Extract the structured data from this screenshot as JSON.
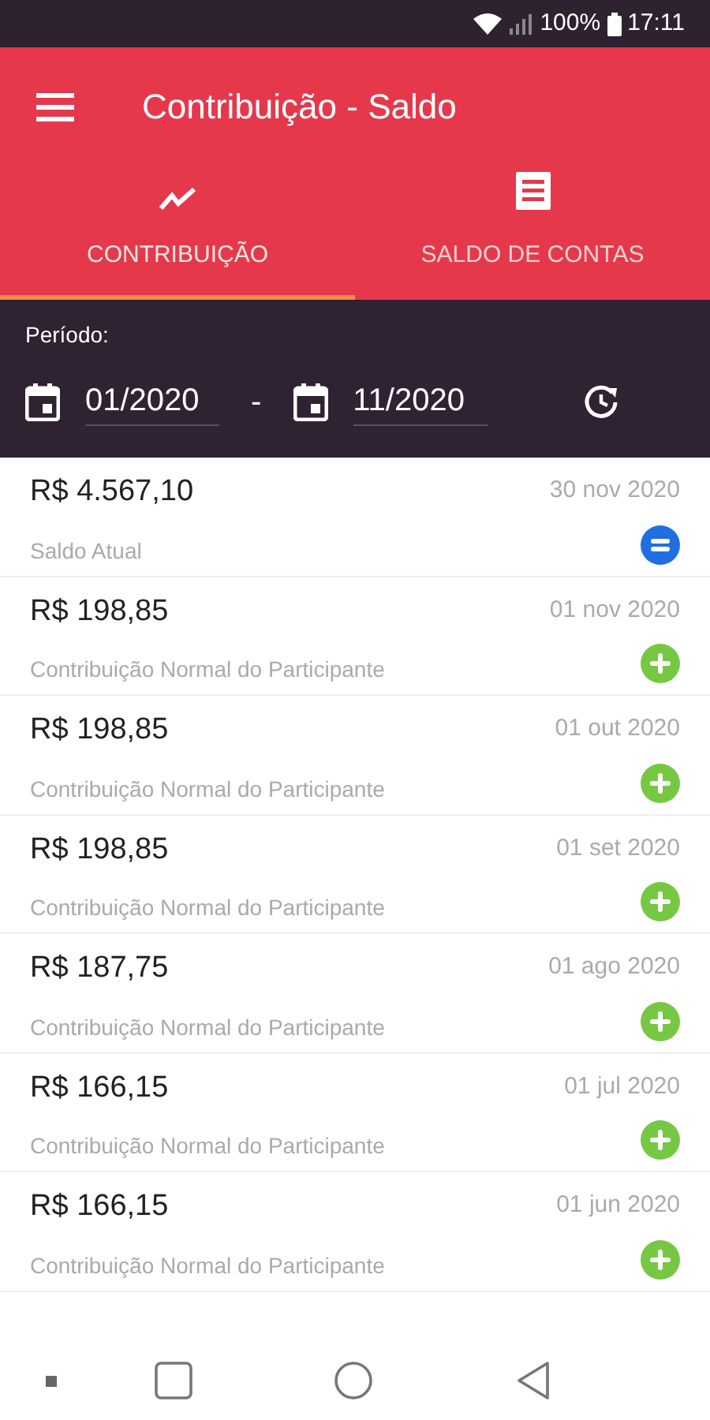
{
  "status_bar": {
    "battery": "100%",
    "time": "17:11"
  },
  "app_bar": {
    "title": "Contribuição - Saldo"
  },
  "tabs": [
    {
      "label": "CONTRIBUIÇÃO",
      "kind": "chart",
      "selected": true
    },
    {
      "label": "SALDO DE CONTAS",
      "kind": "list",
      "selected": false
    }
  ],
  "period": {
    "label": "Período:",
    "start": "01/2020",
    "separator": "-",
    "end": "11/2020"
  },
  "entries": [
    {
      "kind": "balance",
      "amount": "R$ 4.567,10",
      "date": "30 nov 2020",
      "description": "Saldo Atual"
    },
    {
      "kind": "credit",
      "amount": "R$ 198,85",
      "date": "01 nov 2020",
      "description": "Contribuição Normal do Participante"
    },
    {
      "kind": "credit",
      "amount": "R$ 198,85",
      "date": "01 out 2020",
      "description": "Contribuição Normal do Participante"
    },
    {
      "kind": "credit",
      "amount": "R$ 198,85",
      "date": "01 set 2020",
      "description": "Contribuição Normal do Participante"
    },
    {
      "kind": "credit",
      "amount": "R$ 187,75",
      "date": "01 ago 2020",
      "description": "Contribuição Normal do Participante"
    },
    {
      "kind": "credit",
      "amount": "R$ 166,15",
      "date": "01 jul 2020",
      "description": "Contribuição Normal do Participante"
    },
    {
      "kind": "credit",
      "amount": "R$ 166,15",
      "date": "01 jun 2020",
      "description": "Contribuição Normal do Participante"
    }
  ]
}
